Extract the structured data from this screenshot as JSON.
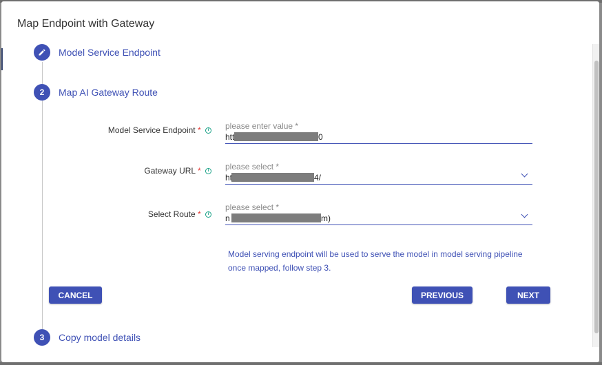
{
  "dialog": {
    "title": "Map Endpoint with Gateway"
  },
  "steps": [
    {
      "number": "",
      "label": "Model Service Endpoint",
      "icon": "pencil-icon"
    },
    {
      "number": "2",
      "label": "Map AI Gateway Route"
    },
    {
      "number": "3",
      "label": "Copy model details"
    }
  ],
  "form": {
    "endpoint": {
      "label": "Model Service Endpoint",
      "required_mark": "*",
      "placeholder": "please enter value *",
      "value_prefix": "htt",
      "value_suffix": "0"
    },
    "gateway_url": {
      "label": "Gateway URL",
      "required_mark": "*",
      "placeholder": "please select *",
      "value_prefix": "ht",
      "value_suffix": "4/"
    },
    "route": {
      "label": "Select Route",
      "required_mark": "*",
      "placeholder": "please select *",
      "value_prefix": "n",
      "value_suffix": "m)"
    },
    "hint_line1": "Model serving endpoint will be used to serve the model in model serving pipeline",
    "hint_line2": "once mapped, follow step 3."
  },
  "buttons": {
    "cancel": "CANCEL",
    "previous": "PREVIOUS",
    "next": "NEXT"
  },
  "colors": {
    "primary": "#3f51b5",
    "required": "#e53935",
    "info": "#16a085"
  }
}
